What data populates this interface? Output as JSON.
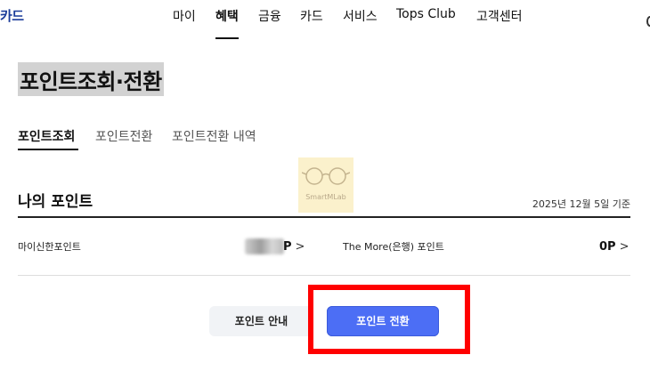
{
  "brand": {
    "label": "카드"
  },
  "nav": {
    "items": [
      {
        "label": "마이"
      },
      {
        "label": "혜택"
      },
      {
        "label": "금융"
      },
      {
        "label": "카드"
      },
      {
        "label": "서비스"
      },
      {
        "label": "Tops Club"
      },
      {
        "label": "고객센터"
      }
    ],
    "active_index": 1
  },
  "page": {
    "title": "포인트조회·전환"
  },
  "tabs": {
    "items": [
      {
        "label": "포인트조회"
      },
      {
        "label": "포인트전환"
      },
      {
        "label": "포인트전환 내역"
      }
    ],
    "active_index": 0
  },
  "watermark": {
    "text": "SmartMLab",
    "icon": "glasses-icon"
  },
  "points": {
    "title": "나의 포인트",
    "date": "2025년 12월 5일 기준",
    "rows": [
      {
        "label": "마이신한포인트",
        "value": "P",
        "value_obscured": true,
        "chevron": ">"
      },
      {
        "label": "The More(은행) 포인트",
        "value": "0P",
        "chevron": ">"
      }
    ]
  },
  "actions": {
    "guide_label": "포인트 안내",
    "convert_label": "포인트 전환"
  },
  "colors": {
    "brand": "#1b3c9a",
    "primary_button": "#4c6ef5",
    "highlight": "#ff0000",
    "title_highlight_bg": "#d2d2d2"
  }
}
